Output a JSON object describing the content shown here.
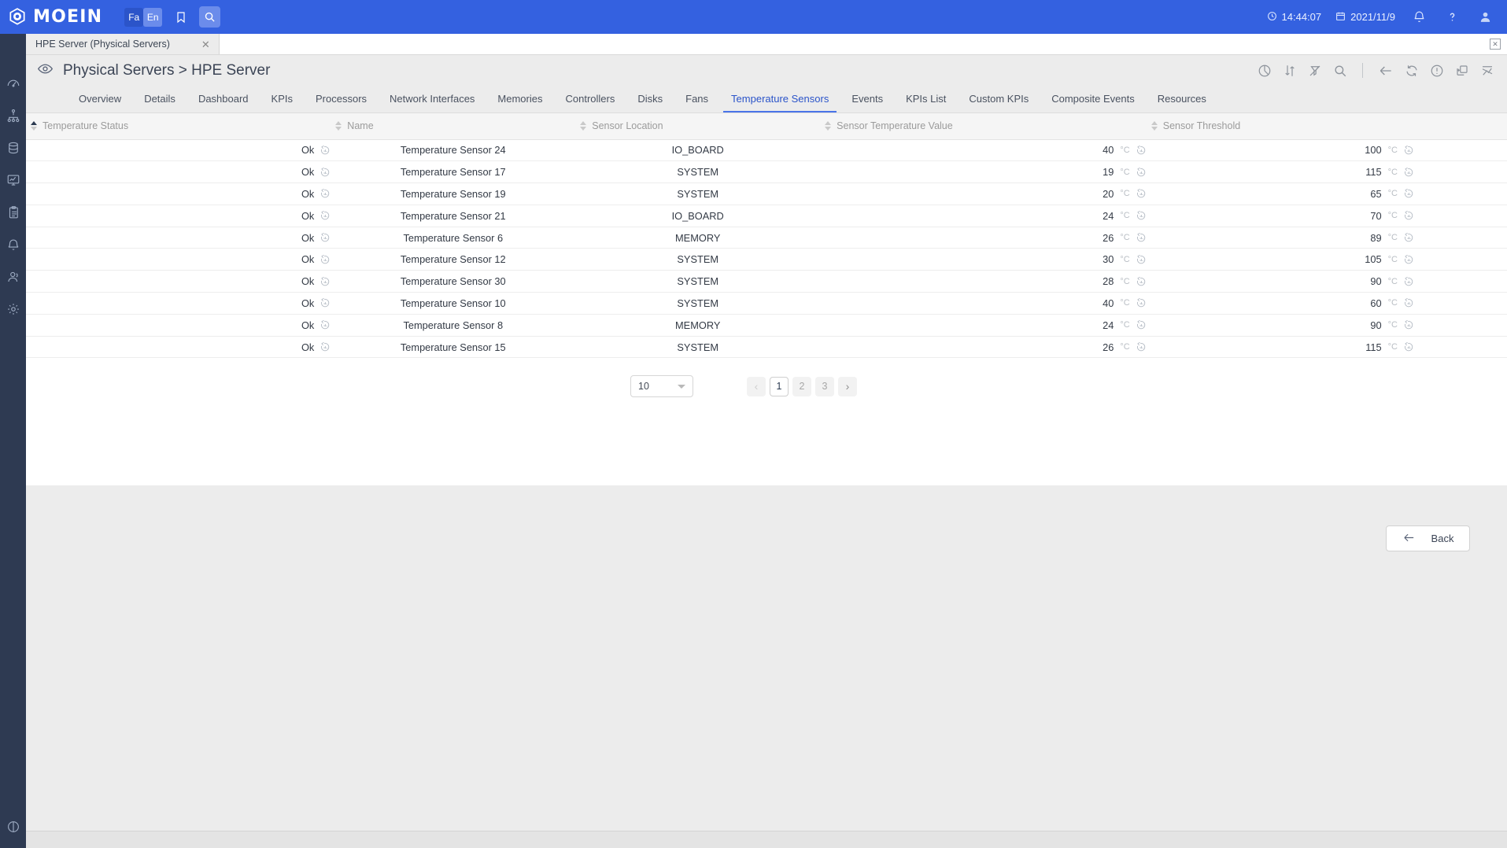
{
  "header": {
    "brand": "MOEIN",
    "logo_icon": "moein-logo-icon",
    "lang_fa": "Fa",
    "lang_en": "En",
    "bookmark_icon": "bookmark-icon",
    "search_icon": "search-icon",
    "time": "14:44:07",
    "date": "2021/11/9",
    "clock_icon": "clock-icon",
    "calendar_icon": "calendar-icon",
    "notification_icon": "bell-icon",
    "help_icon": "question-mark-icon",
    "user_icon": "user-avatar-icon",
    "accent_color": "#3461e0"
  },
  "sidebar": {
    "items": [
      {
        "icon": "gauge-icon",
        "label": "Dashboard"
      },
      {
        "icon": "hierarchy-icon",
        "label": "Topology"
      },
      {
        "icon": "database-icon",
        "label": "Inventory"
      },
      {
        "icon": "monitor-chart-icon",
        "label": "Monitoring"
      },
      {
        "icon": "clipboard-icon",
        "label": "Reports"
      },
      {
        "icon": "bell-icon",
        "label": "Alerts"
      },
      {
        "icon": "users-icon",
        "label": "Users"
      },
      {
        "icon": "gear-icon",
        "label": "Settings"
      }
    ],
    "bottom_icon": "collapse-icon"
  },
  "document_tab": {
    "title": "HPE Server (Physical Servers)",
    "close_icon": "close-icon",
    "close_all_icon": "close-all-tabs-icon"
  },
  "page": {
    "eye_icon": "eye-icon",
    "title": "Physical Servers > HPE Server",
    "toolbar": [
      {
        "icon": "pie-chart-icon",
        "name": "chart-view-button"
      },
      {
        "icon": "sort-arrows-icon",
        "name": "sort-button"
      },
      {
        "icon": "no-filter-icon",
        "name": "clear-filter-button"
      },
      {
        "icon": "search-icon",
        "name": "search-button"
      },
      {
        "icon": "arrow-left-icon",
        "name": "back-nav-button"
      },
      {
        "icon": "refresh-icon",
        "name": "refresh-button"
      },
      {
        "icon": "info-circle-icon",
        "name": "info-button"
      },
      {
        "icon": "duplicate-icon",
        "name": "duplicate-button"
      },
      {
        "icon": "chart-cross-icon",
        "name": "analytics-button"
      }
    ]
  },
  "nav_tabs": {
    "active": "Temperature Sensors",
    "items": [
      "Overview",
      "Details",
      "Dashboard",
      "KPIs",
      "Processors",
      "Network Interfaces",
      "Memories",
      "Controllers",
      "Disks",
      "Fans",
      "Temperature Sensors",
      "Events",
      "KPIs List",
      "Custom KPIs",
      "Composite Events",
      "Resources"
    ]
  },
  "table": {
    "columns": [
      {
        "label": "Temperature Status",
        "sorted": "asc"
      },
      {
        "label": "Name",
        "sorted": "none"
      },
      {
        "label": "Sensor Location",
        "sorted": "none"
      },
      {
        "label": "Sensor Temperature Value",
        "sorted": "none"
      },
      {
        "label": "Sensor Threshold",
        "sorted": "none"
      }
    ],
    "unit": "°C",
    "history_icon": "history-chart-icon",
    "rows": [
      {
        "status": "Ok",
        "name": "Temperature Sensor 24",
        "location": "IO_BOARD",
        "value": "40",
        "threshold": "100"
      },
      {
        "status": "Ok",
        "name": "Temperature Sensor 17",
        "location": "SYSTEM",
        "value": "19",
        "threshold": "115"
      },
      {
        "status": "Ok",
        "name": "Temperature Sensor 19",
        "location": "SYSTEM",
        "value": "20",
        "threshold": "65"
      },
      {
        "status": "Ok",
        "name": "Temperature Sensor 21",
        "location": "IO_BOARD",
        "value": "24",
        "threshold": "70"
      },
      {
        "status": "Ok",
        "name": "Temperature Sensor 6",
        "location": "MEMORY",
        "value": "26",
        "threshold": "89"
      },
      {
        "status": "Ok",
        "name": "Temperature Sensor 12",
        "location": "SYSTEM",
        "value": "30",
        "threshold": "105"
      },
      {
        "status": "Ok",
        "name": "Temperature Sensor 30",
        "location": "SYSTEM",
        "value": "28",
        "threshold": "90"
      },
      {
        "status": "Ok",
        "name": "Temperature Sensor 10",
        "location": "SYSTEM",
        "value": "40",
        "threshold": "60"
      },
      {
        "status": "Ok",
        "name": "Temperature Sensor 8",
        "location": "MEMORY",
        "value": "24",
        "threshold": "90"
      },
      {
        "status": "Ok",
        "name": "Temperature Sensor 15",
        "location": "SYSTEM",
        "value": "26",
        "threshold": "115"
      }
    ]
  },
  "pagination": {
    "page_size": "10",
    "prev_icon": "chevron-left-icon",
    "next_icon": "chevron-right-icon",
    "pages": [
      "1",
      "2",
      "3"
    ],
    "current_page": "1"
  },
  "footer": {
    "back_label": "Back",
    "back_icon": "arrow-left-icon"
  }
}
